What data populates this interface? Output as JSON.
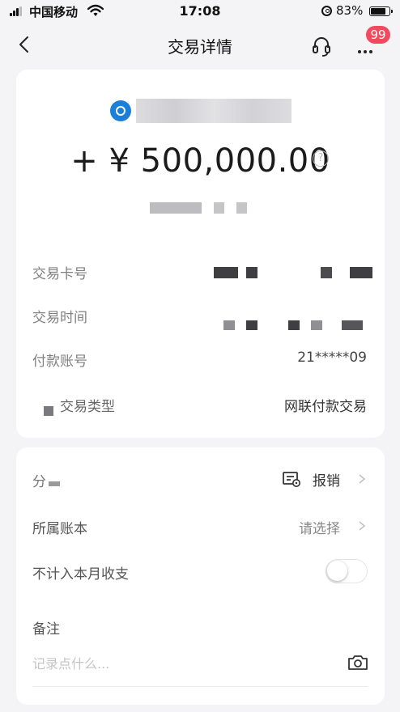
{
  "status_bar": {
    "carrier": "中国移动",
    "time": "17:08",
    "battery": "83%",
    "battery_level": 0.83
  },
  "nav": {
    "title": "交易详情",
    "badge": "99",
    "icons": [
      "back-arrow-icon",
      "headset-icon",
      "more-icon"
    ]
  },
  "transaction": {
    "amount": "+ ¥ 500,000.00",
    "help_symbol": "?",
    "rows": [
      {
        "label": "交易卡号",
        "value": ""
      },
      {
        "label": "交易时间",
        "value": ""
      },
      {
        "label": "付款账号",
        "value": "21*****09"
      },
      {
        "label": "交易类型",
        "value": "网联付款交易"
      }
    ]
  },
  "options": {
    "category_label": "分",
    "category_value": "报销",
    "ledger_label": "所属账本",
    "ledger_value": "请选择",
    "exclude_label": "不计入本月收支",
    "exclude_on": false,
    "note_label": "备注",
    "note_placeholder": "记录点什么..."
  },
  "colors": {
    "background": "#f4f4f6",
    "badge": "#f2495e",
    "payee_icon": "#1a7fd8"
  }
}
